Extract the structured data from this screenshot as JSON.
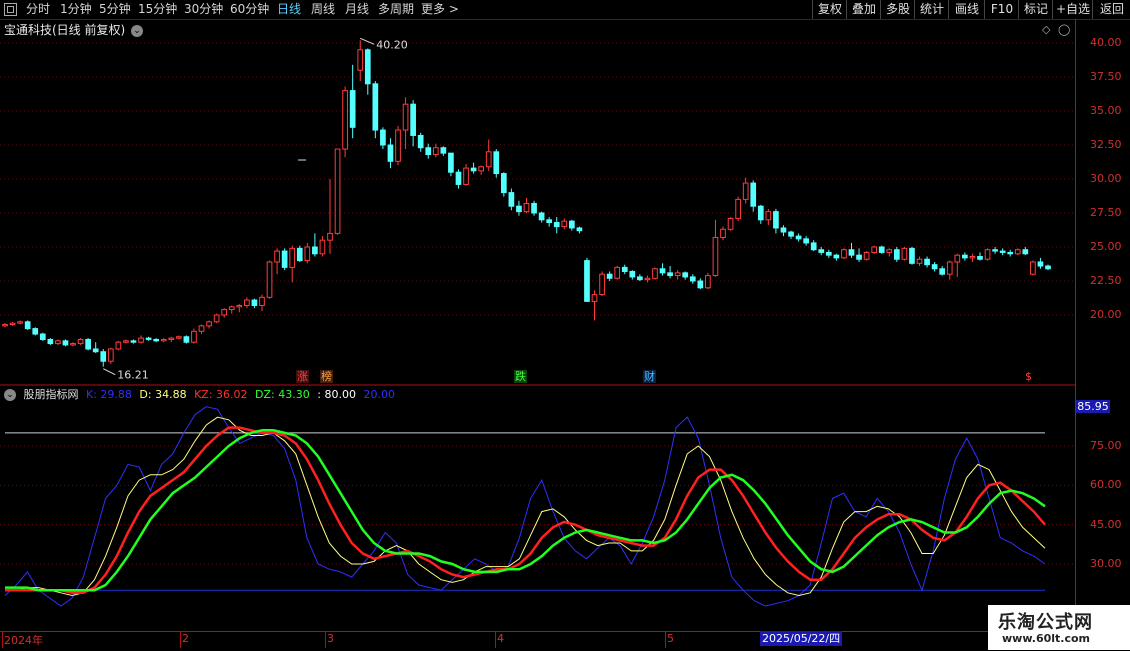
{
  "toolbar": {
    "periods": [
      "分时",
      "1分钟",
      "5分钟",
      "15分钟",
      "30分钟",
      "60分钟",
      "日线",
      "周线",
      "月线",
      "多周期",
      "更多 >"
    ],
    "active_period": "日线",
    "right_buttons": [
      "复权",
      "叠加",
      "多股",
      "统计",
      "画线",
      "F10",
      "标记",
      "+自选",
      "返回"
    ]
  },
  "main_chart": {
    "title": "宝通科技(日线 前复权)",
    "high_label": "40.20",
    "low_label": "16.21",
    "y_ticks": [
      "40.00",
      "37.50",
      "35.00",
      "32.50",
      "30.00",
      "27.50",
      "25.00",
      "22.50",
      "20.00"
    ],
    "events": [
      {
        "label": "涨",
        "color": "#ff4040",
        "bg": "#401010"
      },
      {
        "label": "榜",
        "color": "#ffa040",
        "bg": "#402010"
      },
      {
        "label": "跌",
        "color": "#40ff40",
        "bg": "#104010"
      },
      {
        "label": "财",
        "color": "#40c0ff",
        "bg": "#102040"
      },
      {
        "label": "$",
        "color": "#ff4040",
        "bg": "#000"
      }
    ]
  },
  "indicator": {
    "name": "股朋指标网",
    "k_label": "K: 29.88",
    "d_label": "D: 34.88",
    "kz_label": "KZ: 36.02",
    "dz_label": "DZ: 43.30",
    "upper_label": ": 80.00",
    "lower_label": "20.00",
    "y_ticks": [
      "75.00",
      "60.00",
      "45.00",
      "30.00"
    ],
    "badge": "85.95"
  },
  "x_axis": {
    "labels": [
      "2024年",
      "2",
      "3",
      "4",
      "5"
    ],
    "cursor_date": "2025/05/22/四"
  },
  "brand": {
    "title": "乐淘公式网",
    "url": "www.60lt.com"
  },
  "colors": {
    "up": "#ff3c3c",
    "down": "#54ffff",
    "k": "#3030ff",
    "d": "#ffff80",
    "kz": "#ff2020",
    "dz": "#20ff20"
  },
  "chart_data": {
    "type": "candlestick",
    "ylim": [
      17.5,
      41.0
    ],
    "candles": [
      [
        19.2,
        19.4,
        19.1,
        19.3
      ],
      [
        19.3,
        19.5,
        19.2,
        19.4
      ],
      [
        19.4,
        19.6,
        19.3,
        19.5
      ],
      [
        19.5,
        19.6,
        18.9,
        19.0
      ],
      [
        19.0,
        19.1,
        18.5,
        18.6
      ],
      [
        18.6,
        18.7,
        18.1,
        18.2
      ],
      [
        18.2,
        18.3,
        17.8,
        17.9
      ],
      [
        17.9,
        18.2,
        17.8,
        18.1
      ],
      [
        18.1,
        18.2,
        17.7,
        17.8
      ],
      [
        17.8,
        18.0,
        17.7,
        17.9
      ],
      [
        17.9,
        18.3,
        17.8,
        18.2
      ],
      [
        18.2,
        18.3,
        17.4,
        17.5
      ],
      [
        17.5,
        18.0,
        17.2,
        17.3
      ],
      [
        17.3,
        17.5,
        16.2,
        16.6
      ],
      [
        16.6,
        17.6,
        16.4,
        17.5
      ],
      [
        17.5,
        18.1,
        17.4,
        18.0
      ],
      [
        18.0,
        18.2,
        17.9,
        18.1
      ],
      [
        18.1,
        18.2,
        17.9,
        18.0
      ],
      [
        18.0,
        18.5,
        17.9,
        18.3
      ],
      [
        18.3,
        18.4,
        18.1,
        18.2
      ],
      [
        18.2,
        18.3,
        18.0,
        18.1
      ],
      [
        18.1,
        18.3,
        18.0,
        18.2
      ],
      [
        18.2,
        18.4,
        18.0,
        18.3
      ],
      [
        18.3,
        18.5,
        18.2,
        18.4
      ],
      [
        18.4,
        18.5,
        17.9,
        18.0
      ],
      [
        18.0,
        19.0,
        17.9,
        18.8
      ],
      [
        18.8,
        19.3,
        18.6,
        19.2
      ],
      [
        19.2,
        19.6,
        19.0,
        19.5
      ],
      [
        19.5,
        20.1,
        19.4,
        20.0
      ],
      [
        20.0,
        20.5,
        19.8,
        20.4
      ],
      [
        20.4,
        20.7,
        20.1,
        20.6
      ],
      [
        20.6,
        20.8,
        20.2,
        20.7
      ],
      [
        20.7,
        21.3,
        20.5,
        21.1
      ],
      [
        21.1,
        21.2,
        20.5,
        20.7
      ],
      [
        20.7,
        21.5,
        20.3,
        21.3
      ],
      [
        21.3,
        24.0,
        21.2,
        23.9
      ],
      [
        23.9,
        24.9,
        23.0,
        24.7
      ],
      [
        24.7,
        24.9,
        23.3,
        23.5
      ],
      [
        23.5,
        25.1,
        22.4,
        24.9
      ],
      [
        24.9,
        25.1,
        23.9,
        24.0
      ],
      [
        24.0,
        25.3,
        23.8,
        25.0
      ],
      [
        25.0,
        26.0,
        24.3,
        24.5
      ],
      [
        24.5,
        25.8,
        24.3,
        25.5
      ],
      [
        25.5,
        30.0,
        24.5,
        26.0
      ],
      [
        26.0,
        32.0,
        25.9,
        32.2
      ],
      [
        32.2,
        36.8,
        31.6,
        36.5
      ],
      [
        36.5,
        38.4,
        33.0,
        33.8
      ],
      [
        38.0,
        40.2,
        37.2,
        39.5
      ],
      [
        39.5,
        39.6,
        36.2,
        37.0
      ],
      [
        37.0,
        37.2,
        33.0,
        33.6
      ],
      [
        33.6,
        33.8,
        32.2,
        32.5
      ],
      [
        32.5,
        33.0,
        30.8,
        31.3
      ],
      [
        31.3,
        33.9,
        31.0,
        33.6
      ],
      [
        33.6,
        36.0,
        32.2,
        35.5
      ],
      [
        35.5,
        35.8,
        32.4,
        33.2
      ],
      [
        33.2,
        33.4,
        32.0,
        32.3
      ],
      [
        32.3,
        32.6,
        31.5,
        31.8
      ],
      [
        31.8,
        32.6,
        31.6,
        32.3
      ],
      [
        32.3,
        32.4,
        31.7,
        31.9
      ],
      [
        31.9,
        31.9,
        30.2,
        30.5
      ],
      [
        30.5,
        30.7,
        29.3,
        29.6
      ],
      [
        29.6,
        31.1,
        29.5,
        30.8
      ],
      [
        30.8,
        31.2,
        30.4,
        30.6
      ],
      [
        30.6,
        31.0,
        30.3,
        30.9
      ],
      [
        30.9,
        32.9,
        30.6,
        32.0
      ],
      [
        32.0,
        32.2,
        30.1,
        30.4
      ],
      [
        30.4,
        30.5,
        28.7,
        29.0
      ],
      [
        29.0,
        29.3,
        27.7,
        28.0
      ],
      [
        28.0,
        28.4,
        27.3,
        27.6
      ],
      [
        27.6,
        28.6,
        27.5,
        28.2
      ],
      [
        28.2,
        28.4,
        27.3,
        27.5
      ],
      [
        27.5,
        27.6,
        26.8,
        27.0
      ],
      [
        27.0,
        27.2,
        26.5,
        26.8
      ],
      [
        26.8,
        27.2,
        26.0,
        26.5
      ],
      [
        26.5,
        27.1,
        26.3,
        26.9
      ],
      [
        26.9,
        27.0,
        26.2,
        26.4
      ],
      [
        26.4,
        26.5,
        26.0,
        26.2
      ],
      [
        24.0,
        24.2,
        21.0,
        21.0
      ],
      [
        21.0,
        21.8,
        19.6,
        21.5
      ],
      [
        21.5,
        23.2,
        21.4,
        23.0
      ],
      [
        23.0,
        23.2,
        22.5,
        22.7
      ],
      [
        22.7,
        23.6,
        22.6,
        23.5
      ],
      [
        23.5,
        23.7,
        23.0,
        23.2
      ],
      [
        23.2,
        23.3,
        22.6,
        22.8
      ],
      [
        22.8,
        23.0,
        22.5,
        22.6
      ],
      [
        22.6,
        22.9,
        22.4,
        22.7
      ],
      [
        22.7,
        23.5,
        22.6,
        23.4
      ],
      [
        23.4,
        23.8,
        22.9,
        23.1
      ],
      [
        23.1,
        23.6,
        22.7,
        22.9
      ],
      [
        22.9,
        23.3,
        22.6,
        23.1
      ],
      [
        23.1,
        23.2,
        22.6,
        22.8
      ],
      [
        22.8,
        23.0,
        22.3,
        22.5
      ],
      [
        22.5,
        22.7,
        21.9,
        22.0
      ],
      [
        22.0,
        23.1,
        21.9,
        22.9
      ],
      [
        22.9,
        27.0,
        22.8,
        25.7
      ],
      [
        25.7,
        26.5,
        25.5,
        26.3
      ],
      [
        26.3,
        27.2,
        26.2,
        27.1
      ],
      [
        27.1,
        28.7,
        26.9,
        28.5
      ],
      [
        28.5,
        30.1,
        28.2,
        29.7
      ],
      [
        29.7,
        29.9,
        27.6,
        28.0
      ],
      [
        28.0,
        28.1,
        26.7,
        27.0
      ],
      [
        27.0,
        27.8,
        26.6,
        27.6
      ],
      [
        27.6,
        27.8,
        26.0,
        26.4
      ],
      [
        26.4,
        26.6,
        25.8,
        26.1
      ],
      [
        26.1,
        26.2,
        25.6,
        25.8
      ],
      [
        25.8,
        26.0,
        25.4,
        25.6
      ],
      [
        25.6,
        25.8,
        25.1,
        25.3
      ],
      [
        25.3,
        25.5,
        24.7,
        24.8
      ],
      [
        24.8,
        25.0,
        24.4,
        24.6
      ],
      [
        24.6,
        24.8,
        24.2,
        24.4
      ],
      [
        24.4,
        24.5,
        24.0,
        24.2
      ],
      [
        24.2,
        24.9,
        24.1,
        24.8
      ],
      [
        24.8,
        25.3,
        24.2,
        24.4
      ],
      [
        24.4,
        24.9,
        23.9,
        24.1
      ],
      [
        24.1,
        24.7,
        24.0,
        24.6
      ],
      [
        24.6,
        25.1,
        24.5,
        25.0
      ],
      [
        25.0,
        25.1,
        24.5,
        24.6
      ],
      [
        24.6,
        24.9,
        24.3,
        24.8
      ],
      [
        24.8,
        25.0,
        23.9,
        24.1
      ],
      [
        24.1,
        25.0,
        24.0,
        24.9
      ],
      [
        24.9,
        25.0,
        23.7,
        23.8
      ],
      [
        23.8,
        24.3,
        23.6,
        24.1
      ],
      [
        24.1,
        24.3,
        23.5,
        23.7
      ],
      [
        23.7,
        23.9,
        23.2,
        23.4
      ],
      [
        23.4,
        23.6,
        22.9,
        23.0
      ],
      [
        23.0,
        24.0,
        22.6,
        23.9
      ],
      [
        23.9,
        24.5,
        22.8,
        24.4
      ],
      [
        24.4,
        24.6,
        24.0,
        24.2
      ],
      [
        24.2,
        24.5,
        23.9,
        24.3
      ],
      [
        24.3,
        24.6,
        24.0,
        24.1
      ],
      [
        24.1,
        24.9,
        24.0,
        24.8
      ],
      [
        24.8,
        25.0,
        24.5,
        24.7
      ],
      [
        24.7,
        24.9,
        24.4,
        24.6
      ],
      [
        24.6,
        24.8,
        24.3,
        24.5
      ],
      [
        24.5,
        24.9,
        24.4,
        24.8
      ],
      [
        24.8,
        25.0,
        24.4,
        24.5
      ],
      [
        23.0,
        24.0,
        22.9,
        23.9
      ],
      [
        23.9,
        24.2,
        23.4,
        23.6
      ],
      [
        23.6,
        23.7,
        23.3,
        23.4
      ]
    ],
    "k": [
      18,
      22,
      27,
      20,
      17,
      14,
      17,
      25,
      40,
      55,
      60,
      68,
      67,
      58,
      68,
      72,
      80,
      87,
      90,
      89,
      82,
      76,
      78,
      80,
      79,
      74,
      62,
      40,
      30,
      28,
      27,
      25,
      30,
      35,
      42,
      38,
      26,
      22,
      21,
      20,
      24,
      28,
      32,
      30,
      27,
      29,
      40,
      55,
      62,
      50,
      40,
      35,
      32,
      36,
      40,
      37,
      30,
      38,
      48,
      62,
      82,
      86,
      78,
      60,
      40,
      25,
      20,
      16,
      14,
      15,
      16,
      18,
      22,
      38,
      55,
      57,
      50,
      48,
      55,
      50,
      42,
      30,
      20,
      35,
      55,
      70,
      78,
      70,
      55,
      40,
      38,
      35,
      33,
      30
    ],
    "d": [
      20,
      20,
      21,
      21,
      20,
      19,
      18,
      19,
      24,
      33,
      44,
      56,
      62,
      64,
      64,
      66,
      70,
      77,
      83,
      86,
      85,
      81,
      79,
      79,
      80,
      77,
      72,
      60,
      48,
      38,
      33,
      30,
      30,
      31,
      35,
      37,
      35,
      30,
      27,
      24,
      23,
      24,
      27,
      29,
      29,
      29,
      32,
      41,
      50,
      51,
      48,
      43,
      39,
      37,
      38,
      38,
      35,
      35,
      39,
      47,
      60,
      72,
      75,
      71,
      62,
      50,
      40,
      32,
      26,
      22,
      19,
      18,
      19,
      25,
      36,
      46,
      50,
      50,
      52,
      51,
      48,
      42,
      34,
      34,
      41,
      52,
      63,
      68,
      66,
      58,
      50,
      44,
      40,
      36
    ],
    "kz": [
      20,
      20,
      20,
      20,
      20,
      20,
      19,
      19,
      21,
      26,
      33,
      42,
      50,
      56,
      59,
      62,
      65,
      70,
      75,
      79,
      82,
      82,
      81,
      80,
      80,
      79,
      76,
      70,
      62,
      53,
      45,
      38,
      34,
      32,
      33,
      34,
      35,
      33,
      31,
      28,
      26,
      25,
      26,
      27,
      28,
      28,
      30,
      34,
      40,
      44,
      46,
      45,
      43,
      41,
      40,
      39,
      38,
      37,
      37,
      40,
      47,
      56,
      63,
      66,
      66,
      62,
      56,
      49,
      42,
      36,
      31,
      27,
      24,
      24,
      28,
      34,
      40,
      44,
      47,
      49,
      49,
      47,
      43,
      40,
      39,
      42,
      48,
      55,
      60,
      61,
      58,
      54,
      50,
      45
    ],
    "dz": [
      21,
      21,
      21,
      20,
      20,
      20,
      20,
      20,
      20,
      22,
      27,
      33,
      40,
      47,
      52,
      57,
      60,
      63,
      67,
      71,
      75,
      78,
      80,
      81,
      81,
      80,
      79,
      76,
      71,
      64,
      57,
      50,
      43,
      38,
      35,
      34,
      34,
      34,
      33,
      31,
      30,
      28,
      27,
      27,
      27,
      28,
      28,
      30,
      33,
      37,
      40,
      42,
      43,
      42,
      41,
      40,
      39,
      39,
      38,
      39,
      42,
      47,
      53,
      59,
      63,
      64,
      62,
      58,
      53,
      47,
      41,
      36,
      31,
      28,
      27,
      29,
      33,
      37,
      41,
      44,
      46,
      47,
      46,
      44,
      42,
      42,
      44,
      48,
      53,
      57,
      58,
      57,
      55,
      52
    ]
  }
}
